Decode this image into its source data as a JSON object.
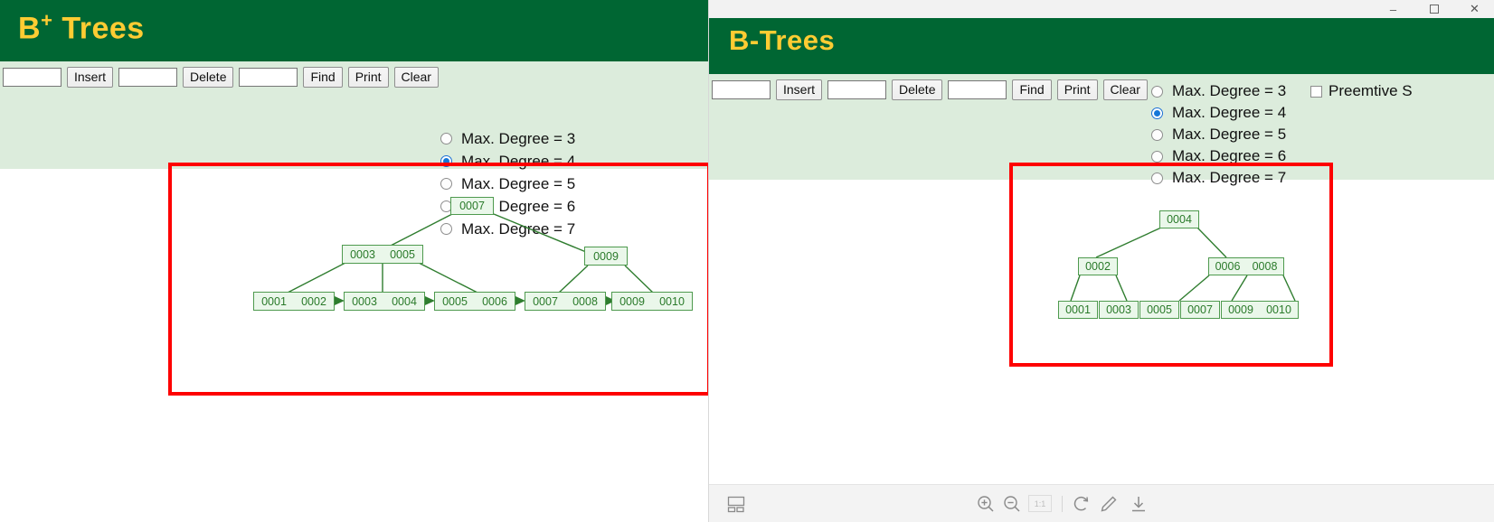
{
  "left_page": {
    "title": "B",
    "title_sup": "+",
    "title_rest": " Trees",
    "toolbar": {
      "insert_value": "",
      "insert_placeholder": "",
      "insert_label": "Insert",
      "delete_value": "",
      "delete_placeholder": "",
      "delete_label": "Delete",
      "find_value": "",
      "find_placeholder": "",
      "find_label": "Find",
      "print_label": "Print",
      "clear_label": "Clear"
    },
    "degree_options": [
      {
        "label": "Max. Degree = 3",
        "value": "3",
        "selected": false
      },
      {
        "label": "Max. Degree = 4",
        "value": "4",
        "selected": true
      },
      {
        "label": "Max. Degree = 5",
        "value": "5",
        "selected": false
      },
      {
        "label": "Max. Degree = 6",
        "value": "6",
        "selected": false
      },
      {
        "label": "Max. Degree = 7",
        "value": "7",
        "selected": false
      }
    ],
    "tree": {
      "type": "b-plus-tree",
      "max_degree": 4,
      "root": {
        "keys": [
          "0007"
        ]
      },
      "internal": [
        {
          "keys": [
            "0003",
            "0005"
          ]
        },
        {
          "keys": [
            "0009"
          ]
        }
      ],
      "leaves": [
        {
          "keys": [
            "0001",
            "0002"
          ]
        },
        {
          "keys": [
            "0003",
            "0004"
          ]
        },
        {
          "keys": [
            "0005",
            "0006"
          ]
        },
        {
          "keys": [
            "0007",
            "0008"
          ]
        },
        {
          "keys": [
            "0009",
            "0010"
          ]
        }
      ],
      "leaf_links": true
    }
  },
  "right_window": {
    "titlebar": {
      "minimize": "–",
      "maximize": "⬜",
      "close": "✕"
    },
    "title": "B-Trees",
    "toolbar": {
      "insert_value": "",
      "insert_placeholder": "",
      "insert_label": "Insert",
      "delete_value": "",
      "delete_placeholder": "",
      "delete_label": "Delete",
      "find_value": "",
      "find_placeholder": "",
      "find_label": "Find",
      "print_label": "Print",
      "clear_label": "Clear"
    },
    "degree_options": [
      {
        "label": "Max. Degree = 3",
        "value": "3",
        "selected": false
      },
      {
        "label": "Max. Degree = 4",
        "value": "4",
        "selected": true
      },
      {
        "label": "Max. Degree = 5",
        "value": "5",
        "selected": false
      },
      {
        "label": "Max. Degree = 6",
        "value": "6",
        "selected": false
      },
      {
        "label": "Max. Degree = 7",
        "value": "7",
        "selected": false
      }
    ],
    "preemptive": {
      "label": "Preemtive S",
      "checked": false
    },
    "tree": {
      "type": "b-tree",
      "max_degree": 4,
      "root": {
        "keys": [
          "0004"
        ]
      },
      "internal": [
        {
          "keys": [
            "0002"
          ]
        },
        {
          "keys": [
            "0006",
            "0008"
          ]
        }
      ],
      "leaves": [
        {
          "keys": [
            "0001"
          ]
        },
        {
          "keys": [
            "0003"
          ]
        },
        {
          "keys": [
            "0005"
          ]
        },
        {
          "keys": [
            "0007"
          ]
        },
        {
          "keys": [
            "0009",
            "0010"
          ]
        }
      ],
      "leaf_links": false
    },
    "viewer_toolbar": {
      "thumbnail_icon": "thumbnail-icon",
      "zoom_in_icon": "zoom-in-icon",
      "zoom_out_icon": "zoom-out-icon",
      "actual_size_label": "1:1",
      "rotate_icon": "rotate-icon",
      "edit_icon": "pencil-icon",
      "download_icon": "download-icon"
    }
  },
  "colors": {
    "header_green": "#006633",
    "title_gold": "#ffcc33",
    "toolbar_green": "#dcecdc",
    "node_fill": "#eaf7ea",
    "node_stroke": "#4e9a4e",
    "node_text": "#2a7a2a",
    "annotation_red": "#fe0000",
    "radio_blue": "#1577d8"
  }
}
